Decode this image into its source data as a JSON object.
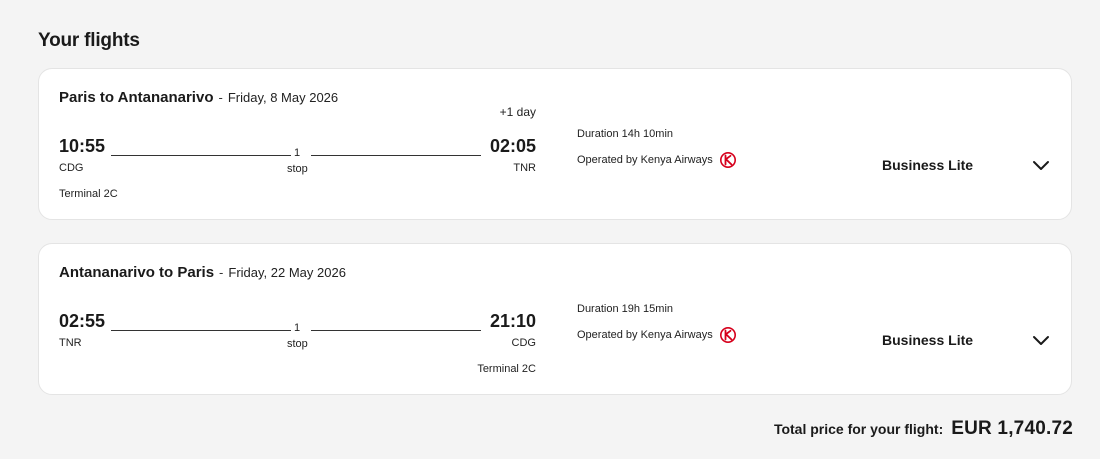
{
  "section_title": "Your flights",
  "flights": [
    {
      "route": "Paris to Antananarivo",
      "separator": "-",
      "date": "Friday, 8 May 2026",
      "day_offset": "+1 day",
      "departure_time": "10:55",
      "departure_code": "CDG",
      "arrival_time": "02:05",
      "arrival_code": "TNR",
      "stops_count": "1",
      "stops_label": "stop",
      "terminal": "Terminal 2C",
      "duration": "Duration 14h 10min",
      "operated_by": "Operated by Kenya Airways",
      "airline_icon": "kenya-airways-logo-icon",
      "cabin": "Business Lite"
    },
    {
      "route": "Antananarivo to Paris",
      "separator": "-",
      "date": "Friday, 22 May 2026",
      "departure_time": "02:55",
      "departure_code": "TNR",
      "arrival_time": "21:10",
      "arrival_code": "CDG",
      "stops_count": "1",
      "stops_label": "stop",
      "terminal": "Terminal 2C",
      "duration": "Duration 19h 15min",
      "operated_by": "Operated by Kenya Airways",
      "airline_icon": "kenya-airways-logo-icon",
      "cabin": "Business Lite"
    }
  ],
  "total": {
    "label": "Total price for your flight:",
    "amount": "EUR 1,740.72"
  },
  "colors": {
    "background": "#f4f4f4",
    "card": "#ffffff",
    "airline_red": "#d6001c"
  }
}
